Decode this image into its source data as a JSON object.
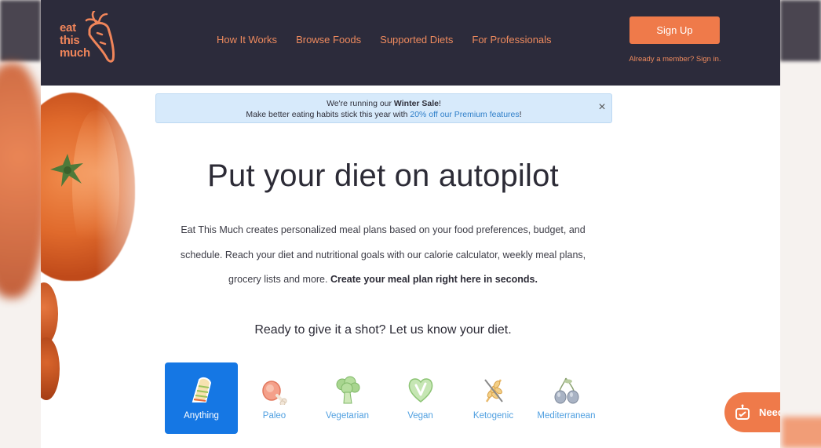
{
  "brand": {
    "logo_lines": [
      "eat",
      "this",
      "much"
    ],
    "accent_color": "#ef7a4a",
    "nav_bg": "#2c2b3b"
  },
  "nav": {
    "links": [
      "How It Works",
      "Browse Foods",
      "Supported Diets",
      "For Professionals"
    ],
    "signup_label": "Sign Up",
    "signin_text": "Already a member? Sign in."
  },
  "banner": {
    "line1_prefix": "We're running our ",
    "line1_bold": "Winter Sale",
    "line1_suffix": "!",
    "line2_prefix": "Make better eating habits stick this year with ",
    "line2_link": "20% off our Premium features",
    "line2_suffix": "!",
    "close_label": "×"
  },
  "hero": {
    "title": "Put your diet on autopilot",
    "body": "Eat This Much creates personalized meal plans based on your food preferences, budget, and schedule. Reach your diet and nutritional goals with our calorie calculator, weekly meal plans, grocery lists and more. ",
    "body_bold": "Create your meal plan right here in seconds.",
    "prompt": "Ready to give it a shot? Let us know your diet."
  },
  "diets": [
    {
      "label": "Anything",
      "icon": "sandwich-icon",
      "selected": true
    },
    {
      "label": "Paleo",
      "icon": "drumstick-icon",
      "selected": false
    },
    {
      "label": "Vegetarian",
      "icon": "broccoli-icon",
      "selected": false
    },
    {
      "label": "Vegan",
      "icon": "vegan-heart-icon",
      "selected": false
    },
    {
      "label": "Ketogenic",
      "icon": "no-wheat-icon",
      "selected": false
    },
    {
      "label": "Mediterranean",
      "icon": "olives-icon",
      "selected": false
    }
  ],
  "help": {
    "label": "Need",
    "icon": "chat-bot-icon"
  }
}
